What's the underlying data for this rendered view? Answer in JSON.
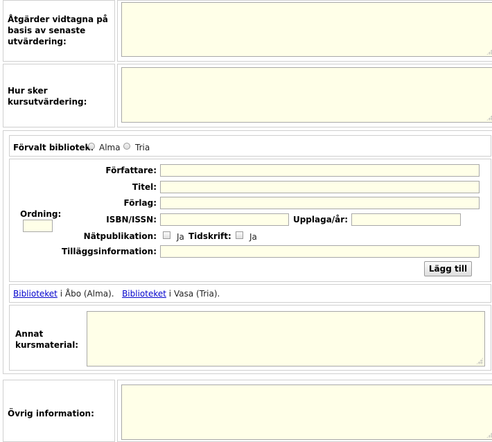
{
  "rows": {
    "actions_taken": {
      "label": "Åtgärder vidtagna på basis av senaste utvärdering:"
    },
    "course_eval": {
      "label": "Hur sker kursutvärdering:"
    }
  },
  "default_library": {
    "label": "Förvalt bibliotek:",
    "options": [
      "Alma",
      "Tria"
    ]
  },
  "book_form": {
    "author_label": "Författare:",
    "title_label": "Titel:",
    "publisher_label": "Förlag:",
    "isbn_label": "ISBN/ISSN:",
    "edition_label": "Upplaga/år:",
    "online_label": "Nätpublikation:",
    "online_option": "Ja",
    "journal_label": "Tidskrift:",
    "journal_option": "Ja",
    "extra_label": "Tilläggsinformation:",
    "order_label": "Ordning:",
    "add_button": "Lägg till"
  },
  "library_links": {
    "link1": "Biblioteket",
    "text1": "i Åbo (Alma).",
    "link2": "Biblioteket",
    "text2": "i Vasa (Tria)."
  },
  "other_material": {
    "label": "Annat kursmaterial:"
  },
  "other_info": {
    "label": "Övrig information:"
  }
}
